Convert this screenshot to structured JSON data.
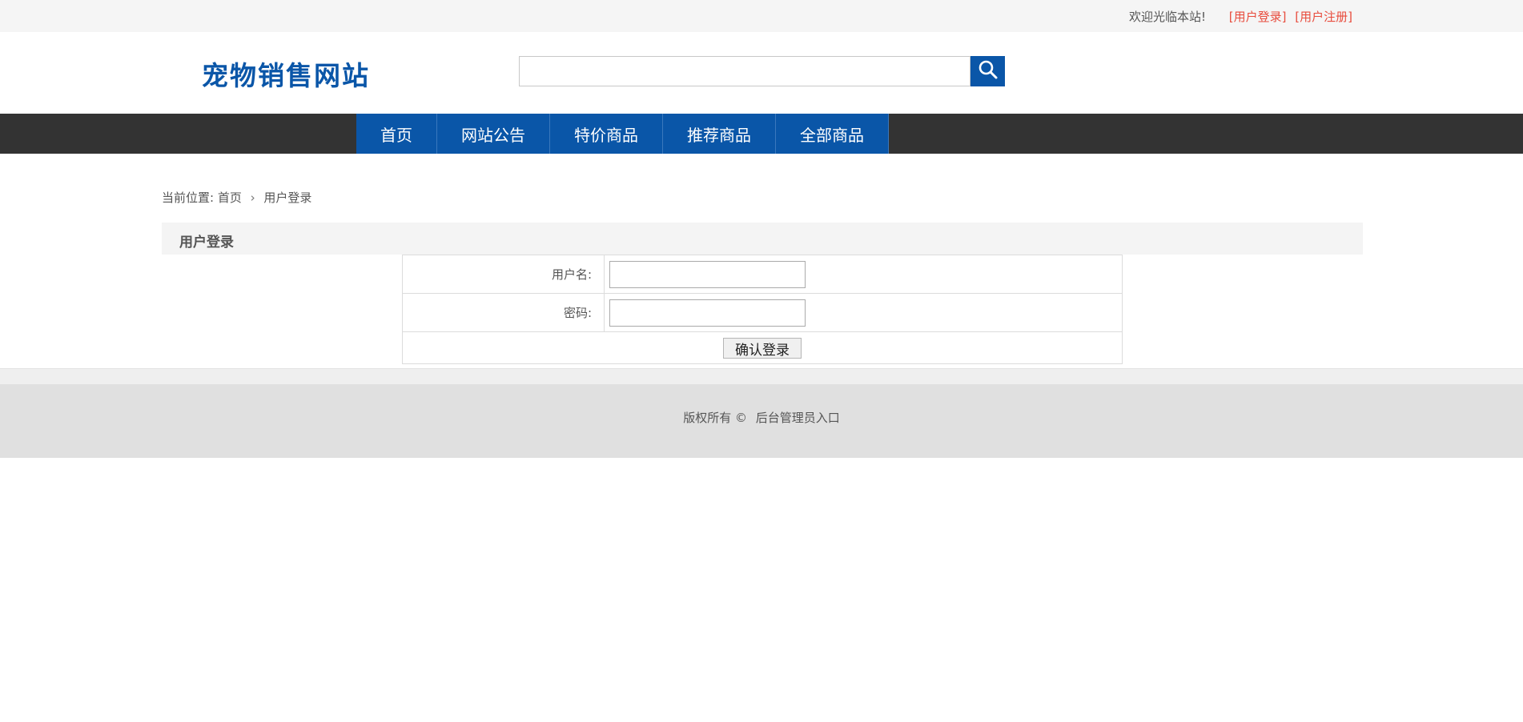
{
  "topbar": {
    "welcome": "欢迎光临本站!",
    "login_link": "[用户登录]",
    "register_link": "[用户注册]"
  },
  "header": {
    "logo": "宠物销售网站",
    "search": {
      "value": "",
      "placeholder": ""
    }
  },
  "nav": {
    "items": [
      "首页",
      "网站公告",
      "特价商品",
      "推荐商品",
      "全部商品"
    ]
  },
  "breadcrumb": {
    "prefix": "当前位置:",
    "home": "首页",
    "current": "用户登录"
  },
  "section": {
    "title": "用户登录"
  },
  "form": {
    "username_label": "用户名:",
    "username_value": "",
    "password_label": "密码:",
    "password_value": "",
    "submit_label": "确认登录"
  },
  "footer": {
    "copyright": "版权所有 ©",
    "admin_link": "后台管理员入口"
  },
  "colors": {
    "brand": "#0a56a8",
    "nav_bg": "#333333",
    "link_red": "#e84c3d"
  }
}
